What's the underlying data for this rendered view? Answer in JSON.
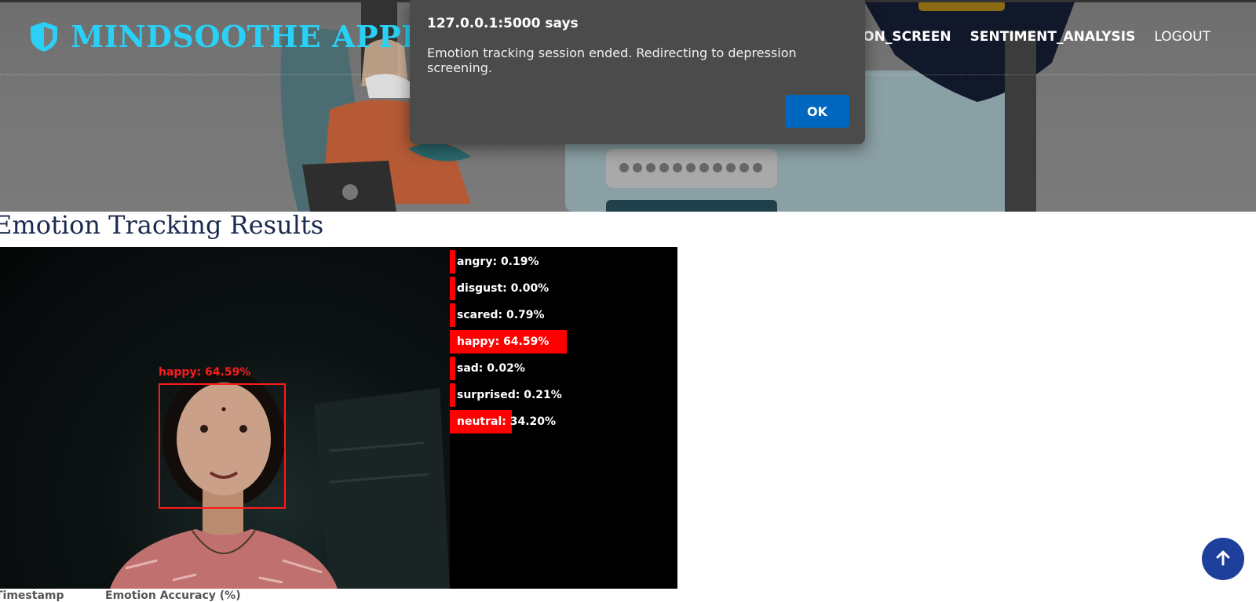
{
  "header": {
    "brand_name": "MINDSOOTHE APPLICATION",
    "brand_color": "#2ad0f5",
    "brand_icon": "shield-icon",
    "nav": [
      {
        "label": "DEPRESSION_SCREEN"
      },
      {
        "label": "SENTIMENT_ANALYSIS"
      },
      {
        "label": "LOGOUT"
      }
    ]
  },
  "dialog": {
    "title": "127.0.0.1:5000 says",
    "message": "Emotion tracking session ended. Redirecting to depression screening.",
    "ok_label": "OK",
    "ok_color": "#0067c0"
  },
  "main": {
    "title": "Emotion Tracking Results",
    "face_label": "happy: 64.59%",
    "emotions": [
      {
        "label": "angry: 0.19%",
        "value": 0.19
      },
      {
        "label": "disgust: 0.00%",
        "value": 0.0
      },
      {
        "label": "scared: 0.79%",
        "value": 0.79
      },
      {
        "label": "happy: 64.59%",
        "value": 64.59
      },
      {
        "label": "sad: 0.02%",
        "value": 0.02
      },
      {
        "label": "surprised: 0.21%",
        "value": 0.21
      },
      {
        "label": "neutral: 34.20%",
        "value": 34.2
      }
    ],
    "bar_color": "#ff0000",
    "table_headers": [
      "Timestamp",
      "Emotion Accuracy (%)"
    ]
  },
  "scroll_top": {
    "icon": "arrow-up-icon",
    "color": "#1f3f9c"
  }
}
